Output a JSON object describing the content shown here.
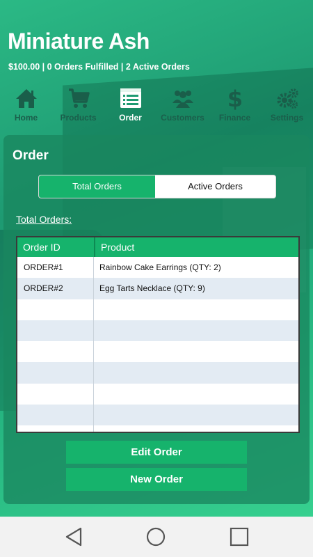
{
  "header": {
    "title": "Miniature Ash",
    "subtitle": "$100.00 | 0 Orders Fulfilled | 2 Active Orders"
  },
  "nav": {
    "items": [
      {
        "label": "Home",
        "icon": "home-icon"
      },
      {
        "label": "Products",
        "icon": "cart-icon"
      },
      {
        "label": "Order",
        "icon": "list-icon"
      },
      {
        "label": "Customers",
        "icon": "people-icon"
      },
      {
        "label": "Finance",
        "icon": "dollar-icon"
      },
      {
        "label": "Settings",
        "icon": "gear-icon"
      }
    ],
    "active": "Order"
  },
  "panel": {
    "title": "Order",
    "tabs": [
      "Total Orders",
      "Active Orders"
    ],
    "section_label": "Total Orders:"
  },
  "table": {
    "headers": [
      "Order ID",
      "Product"
    ],
    "rows": [
      {
        "id": "ORDER#1",
        "product": "Rainbow Cake Earrings (QTY: 2)"
      },
      {
        "id": "ORDER#2",
        "product": "Egg Tarts Necklace (QTY: 9)"
      }
    ]
  },
  "actions": {
    "edit_label": "Edit Order",
    "new_label": "New Order"
  },
  "colors": {
    "accent": "#16b36c",
    "header_bg": "#1f9a70",
    "row_alt": "#e3ebf3"
  }
}
